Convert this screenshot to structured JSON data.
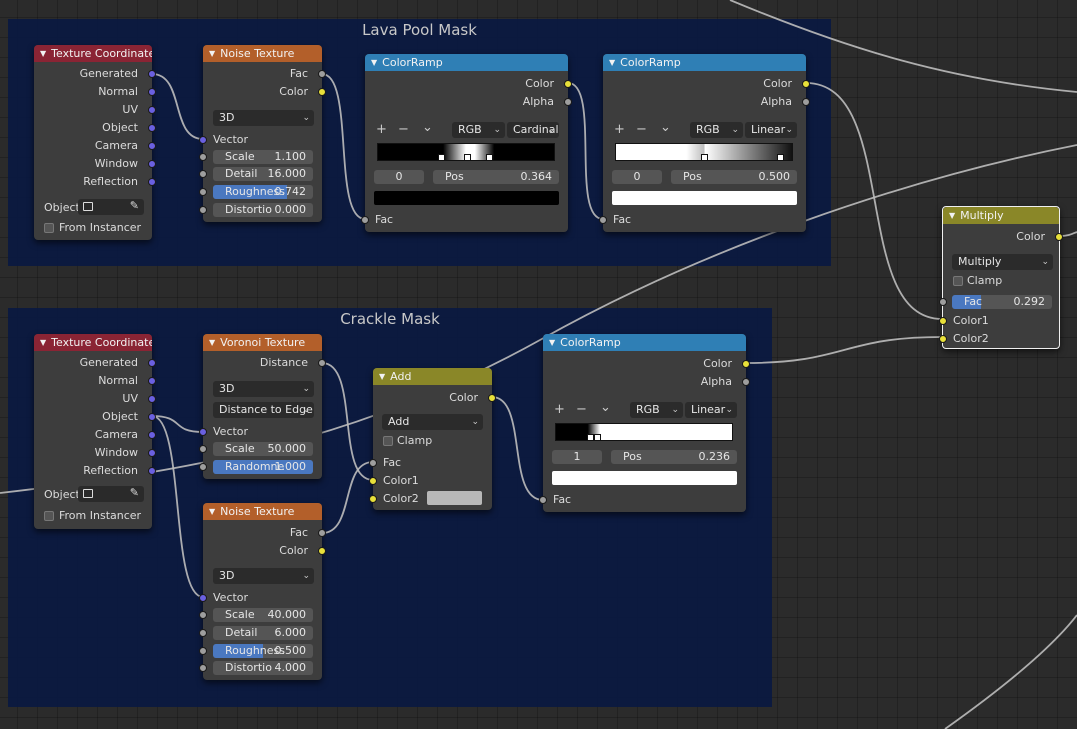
{
  "frames": [
    {
      "title": "Lava Pool Mask"
    },
    {
      "title": "Crackle Mask"
    }
  ],
  "nodes": {
    "tc1": {
      "title": "Texture Coordinate",
      "outputs": [
        "Generated",
        "Normal",
        "UV",
        "Object",
        "Camera",
        "Window",
        "Reflection"
      ],
      "object_label": "Object:",
      "from_instancer": "From Instancer"
    },
    "noise1": {
      "title": "Noise Texture",
      "outputs": [
        "Fac",
        "Color"
      ],
      "dimensions": "3D",
      "vector_label": "Vector",
      "fields": [
        {
          "label": "Scale",
          "value": "1.100"
        },
        {
          "label": "Detail",
          "value": "16.000"
        },
        {
          "label": "Roughness",
          "value": "0.742",
          "fill": 0.742
        },
        {
          "label": "Distortio",
          "value": "0.000"
        }
      ]
    },
    "ramp1": {
      "title": "ColorRamp",
      "outputs": [
        "Color",
        "Alpha"
      ],
      "color_mode": "RGB",
      "interpolation": "Cardinal",
      "stop_index": "0",
      "pos_label": "Pos",
      "pos_value": "0.364",
      "swatch_color": "#000000",
      "input": "Fac"
    },
    "ramp2": {
      "title": "ColorRamp",
      "outputs": [
        "Color",
        "Alpha"
      ],
      "color_mode": "RGB",
      "interpolation": "Linear",
      "stop_index": "0",
      "pos_label": "Pos",
      "pos_value": "0.500",
      "swatch_color": "#ffffff",
      "input": "Fac"
    },
    "mul": {
      "title": "Multiply",
      "output": "Color",
      "blend_type": "Multiply",
      "clamp": "Clamp",
      "fac_label": "Fac",
      "fac_value": "0.292",
      "fac_fill": 0.292,
      "inputs": [
        "Color1",
        "Color2"
      ]
    },
    "tc2": {
      "title": "Texture Coordinate",
      "outputs": [
        "Generated",
        "Normal",
        "UV",
        "Object",
        "Camera",
        "Window",
        "Reflection"
      ],
      "object_label": "Object:",
      "from_instancer": "From Instancer"
    },
    "voronoi": {
      "title": "Voronoi Texture",
      "output": "Distance",
      "dimensions": "3D",
      "feature": "Distance to Edge",
      "vector_label": "Vector",
      "fields": [
        {
          "label": "Scale",
          "value": "50.000"
        },
        {
          "label": "Randomne",
          "value": "1.000",
          "fill": 1.0
        }
      ]
    },
    "noise2": {
      "title": "Noise Texture",
      "outputs": [
        "Fac",
        "Color"
      ],
      "dimensions": "3D",
      "vector_label": "Vector",
      "fields": [
        {
          "label": "Scale",
          "value": "40.000"
        },
        {
          "label": "Detail",
          "value": "6.000"
        },
        {
          "label": "Roughness",
          "value": "0.500",
          "fill": 0.5
        },
        {
          "label": "Distortio",
          "value": "4.000"
        }
      ]
    },
    "add": {
      "title": "Add",
      "output": "Color",
      "blend_type": "Add",
      "clamp": "Clamp",
      "inputs": [
        "Fac",
        "Color1",
        "Color2"
      ],
      "color2_swatch": "#b8b8b8"
    },
    "ramp3": {
      "title": "ColorRamp",
      "outputs": [
        "Color",
        "Alpha"
      ],
      "color_mode": "RGB",
      "interpolation": "Linear",
      "stop_index": "1",
      "pos_label": "Pos",
      "pos_value": "0.236",
      "swatch_color": "#ffffff",
      "input": "Fac"
    }
  },
  "ui": {
    "add_glyph": "+",
    "remove_glyph": "−",
    "menu_glyph": "⌄",
    "collapse_glyph": "▼",
    "eyedropper_icon": "eyedropper-icon"
  },
  "colors": {
    "frame_bg": "#0a1941",
    "header_input": "#8a2434",
    "header_texture": "#b35f2a",
    "header_converter": "#2f7fb5",
    "header_color": "#8a8728",
    "socket_vector": "#6a60e0",
    "socket_color": "#e8e03a",
    "socket_float": "#9e9e9e",
    "field_fill": "#4a78c0"
  }
}
